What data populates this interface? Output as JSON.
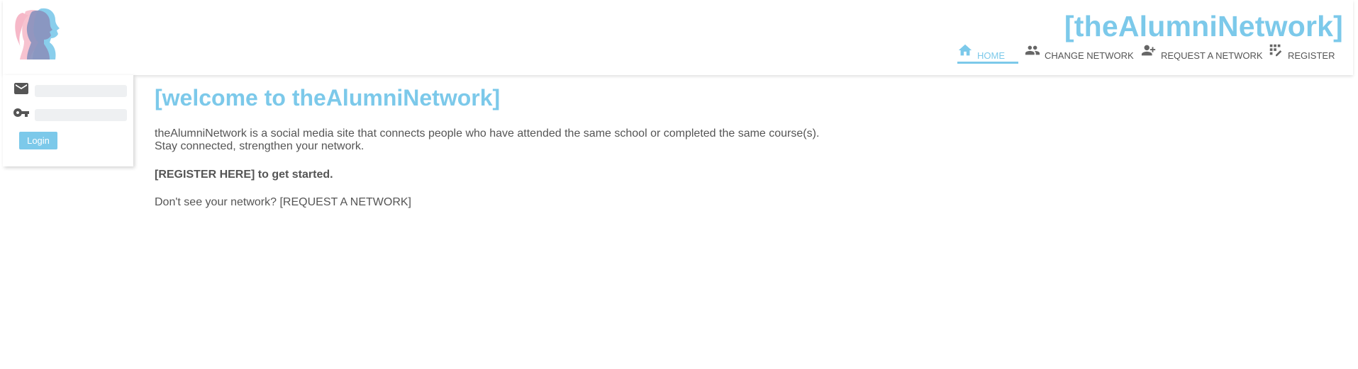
{
  "brand": {
    "title": "[theAlumniNetwork]"
  },
  "colors": {
    "accent": "#7cc9ea",
    "text": "#555555",
    "logo_pink": "#f6b8c8",
    "logo_purple": "#8a92bd"
  },
  "nav": {
    "items": [
      {
        "label": "HOME",
        "icon": "home-icon",
        "active": true
      },
      {
        "label": "CHANGE NETWORK",
        "icon": "people-icon",
        "active": false
      },
      {
        "label": "REQUEST A NETWORK",
        "icon": "person-add-icon",
        "active": false
      },
      {
        "label": "REGISTER",
        "icon": "grid-edit-icon",
        "active": false
      }
    ]
  },
  "login": {
    "email_icon": "email-icon",
    "password_icon": "key-icon",
    "email_value": "",
    "password_value": "",
    "button_label": "Login"
  },
  "main": {
    "heading": "[welcome to theAlumniNetwork]",
    "intro_line1": "theAlumniNetwork is a social media site that connects people who have attended the same school or completed the same course(s).",
    "intro_line2": "Stay connected, strengthen your network.",
    "register_link": "[REGISTER HERE]",
    "register_suffix": " to get started.",
    "request_prefix": "Don't see your network? ",
    "request_link": "[REQUEST A NETWORK]"
  }
}
